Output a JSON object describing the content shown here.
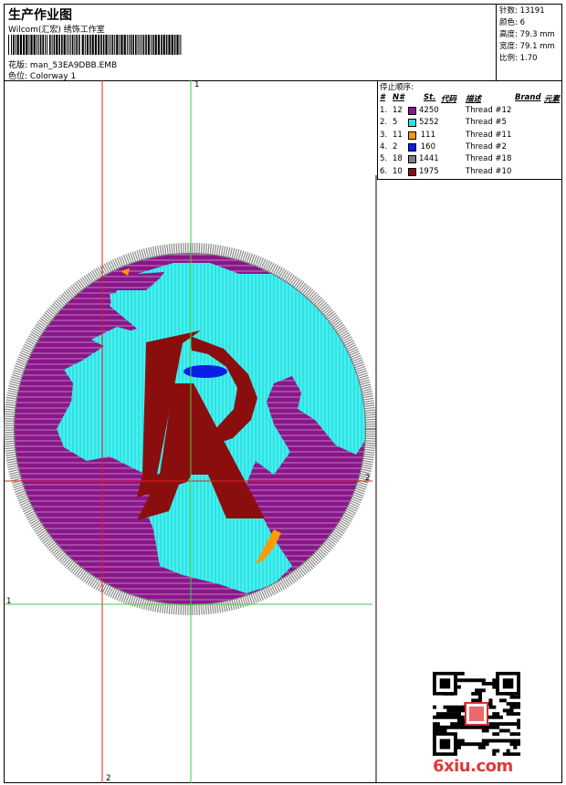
{
  "header": {
    "title": "生产作业图",
    "software": "Wilcom(汇宏) 绣饰工作室",
    "design_label": "花版:",
    "design_file": "man_53EA9DBB.EMB",
    "colorway_label": "色位:",
    "colorway": "Colorway 1"
  },
  "stats": {
    "stitches_label": "针数:",
    "stitches": "13191",
    "colors_label": "颜色:",
    "colors": "6",
    "height_label": "高度:",
    "height": "79.3 mm",
    "width_label": "宽度:",
    "width": "79.1 mm",
    "scale_label": "比例:",
    "scale": "1.70"
  },
  "stop_sequence": {
    "title": "停止顺序:",
    "columns": {
      "num": "#",
      "needle": "N#",
      "stitches": "St.",
      "code": "代码",
      "desc": "描述",
      "brand": "Brand",
      "element": "元素"
    },
    "rows": [
      {
        "num": "1.",
        "needle": "12",
        "color": "#8a168a",
        "stitches": "4250",
        "desc": "Thread #12"
      },
      {
        "num": "2.",
        "needle": "5",
        "color": "#27e6e6",
        "stitches": "5252",
        "desc": "Thread #5"
      },
      {
        "num": "3.",
        "needle": "11",
        "color": "#ff9a00",
        "stitches": "111",
        "desc": "Thread #11"
      },
      {
        "num": "4.",
        "needle": "2",
        "color": "#0a1ee6",
        "stitches": "160",
        "desc": "Thread #2"
      },
      {
        "num": "5.",
        "needle": "18",
        "color": "#808080",
        "stitches": "1441",
        "desc": "Thread #18"
      },
      {
        "num": "6.",
        "needle": "10",
        "color": "#8a0e0e",
        "stitches": "1975",
        "desc": "Thread #10"
      }
    ]
  },
  "guides": {
    "top_marker": "1",
    "right_marker": "2",
    "left_marker": "1",
    "bottom_marker": "2"
  },
  "colors": {
    "purple": "#8a168a",
    "cyan": "#27e6e6",
    "gray_border": "#8a8a8a",
    "maroon": "#8a0e0e",
    "blue": "#0a1ee6",
    "orange": "#ff9a00",
    "guide_red": "#e02020",
    "guide_green": "#3cd23c"
  },
  "watermark": "6xiu.com"
}
